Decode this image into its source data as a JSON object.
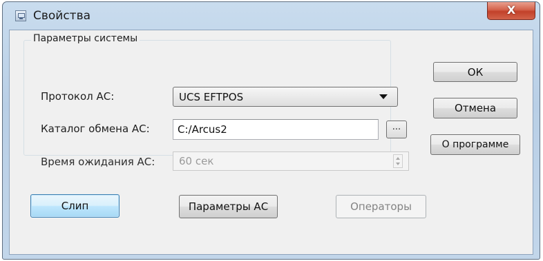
{
  "window": {
    "title": "Свойства",
    "close_glyph": "X"
  },
  "system_params": {
    "group_title": "Параметры системы",
    "protocol": {
      "label": "Протокол АС:",
      "value": "UCS EFTPOS"
    },
    "exchange_dir": {
      "label": "Каталог обмена АС:",
      "value": "C:/Arcus2",
      "browse_label": "..."
    },
    "timeout": {
      "label": "Время ожидания АС:",
      "value": "60 сек"
    }
  },
  "side_buttons": {
    "ok": "ОК",
    "cancel": "Отмена",
    "about": "О программе"
  },
  "bottom_buttons": {
    "slip": "Слип",
    "ac_params": "Параметры АС",
    "operators": "Операторы"
  },
  "icons": {
    "app": "app-window-icon",
    "close": "close-icon",
    "dropdown": "chevron-down-icon",
    "spin": "spin-arrows-icon"
  },
  "colors": {
    "titlebar": "#c2d6ea",
    "client": "#f0f0f0",
    "close_button": "#c2412a",
    "default_button": "#bee6fd"
  }
}
